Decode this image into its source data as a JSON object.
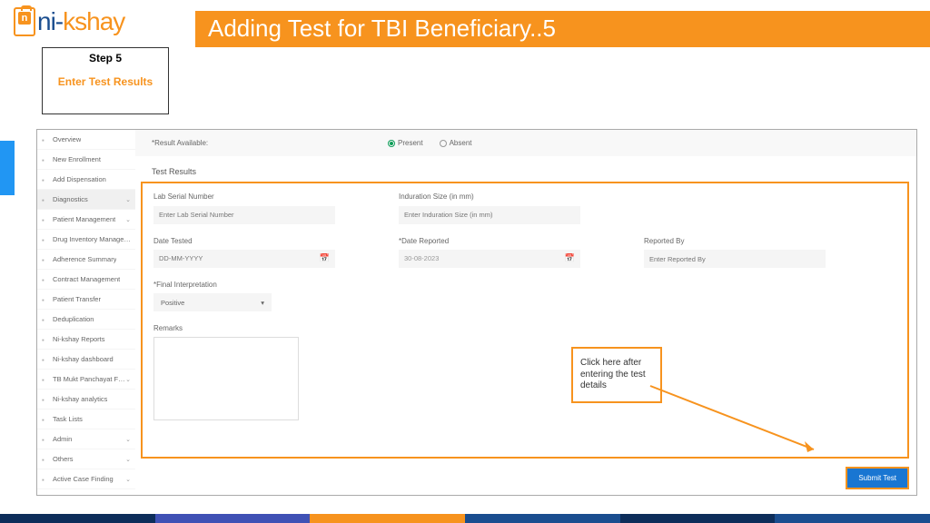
{
  "logo": {
    "part1": "ni",
    "dash": "-",
    "part2": "kshay"
  },
  "title": "Adding Test for TBI Beneficiary..5",
  "step": {
    "number": "Step 5",
    "label": "Enter Test Results"
  },
  "sidebar": [
    {
      "label": "Overview",
      "chev": false
    },
    {
      "label": "New Enrollment",
      "chev": false
    },
    {
      "label": "Add Dispensation",
      "chev": false
    },
    {
      "label": "Diagnostics",
      "chev": true
    },
    {
      "label": "Patient Management",
      "chev": true
    },
    {
      "label": "Drug Inventory Management",
      "chev": false
    },
    {
      "label": "Adherence Summary",
      "chev": false
    },
    {
      "label": "Contract Management",
      "chev": false
    },
    {
      "label": "Patient Transfer",
      "chev": false
    },
    {
      "label": "Deduplication",
      "chev": false
    },
    {
      "label": "Ni-kshay Reports",
      "chev": false
    },
    {
      "label": "Ni-kshay dashboard",
      "chev": false
    },
    {
      "label": "TB Mukt Panchayat Forms",
      "chev": true
    },
    {
      "label": "Ni-kshay analytics",
      "chev": false
    },
    {
      "label": "Task Lists",
      "chev": false
    },
    {
      "label": "Admin",
      "chev": true
    },
    {
      "label": "Others",
      "chev": true
    },
    {
      "label": "Active Case Finding",
      "chev": true
    }
  ],
  "result": {
    "label": "*Result Available:",
    "present": "Present",
    "absent": "Absent"
  },
  "section": "Test Results",
  "fields": {
    "labSerial": {
      "label": "Lab Serial Number",
      "placeholder": "Enter Lab Serial Number"
    },
    "induration": {
      "label": "Induration Size (in mm)",
      "placeholder": "Enter Induration Size (in mm)"
    },
    "dateTested": {
      "label": "Date Tested",
      "placeholder": "DD-MM-YYYY"
    },
    "dateReported": {
      "label": "*Date Reported",
      "value": "30-08-2023"
    },
    "reportedBy": {
      "label": "Reported By",
      "placeholder": "Enter Reported By"
    },
    "interpretation": {
      "label": "*Final Interpretation",
      "value": "Positive"
    },
    "remarks": {
      "label": "Remarks"
    }
  },
  "callout": "Click  here after entering the test details",
  "submit": "Submit Test"
}
